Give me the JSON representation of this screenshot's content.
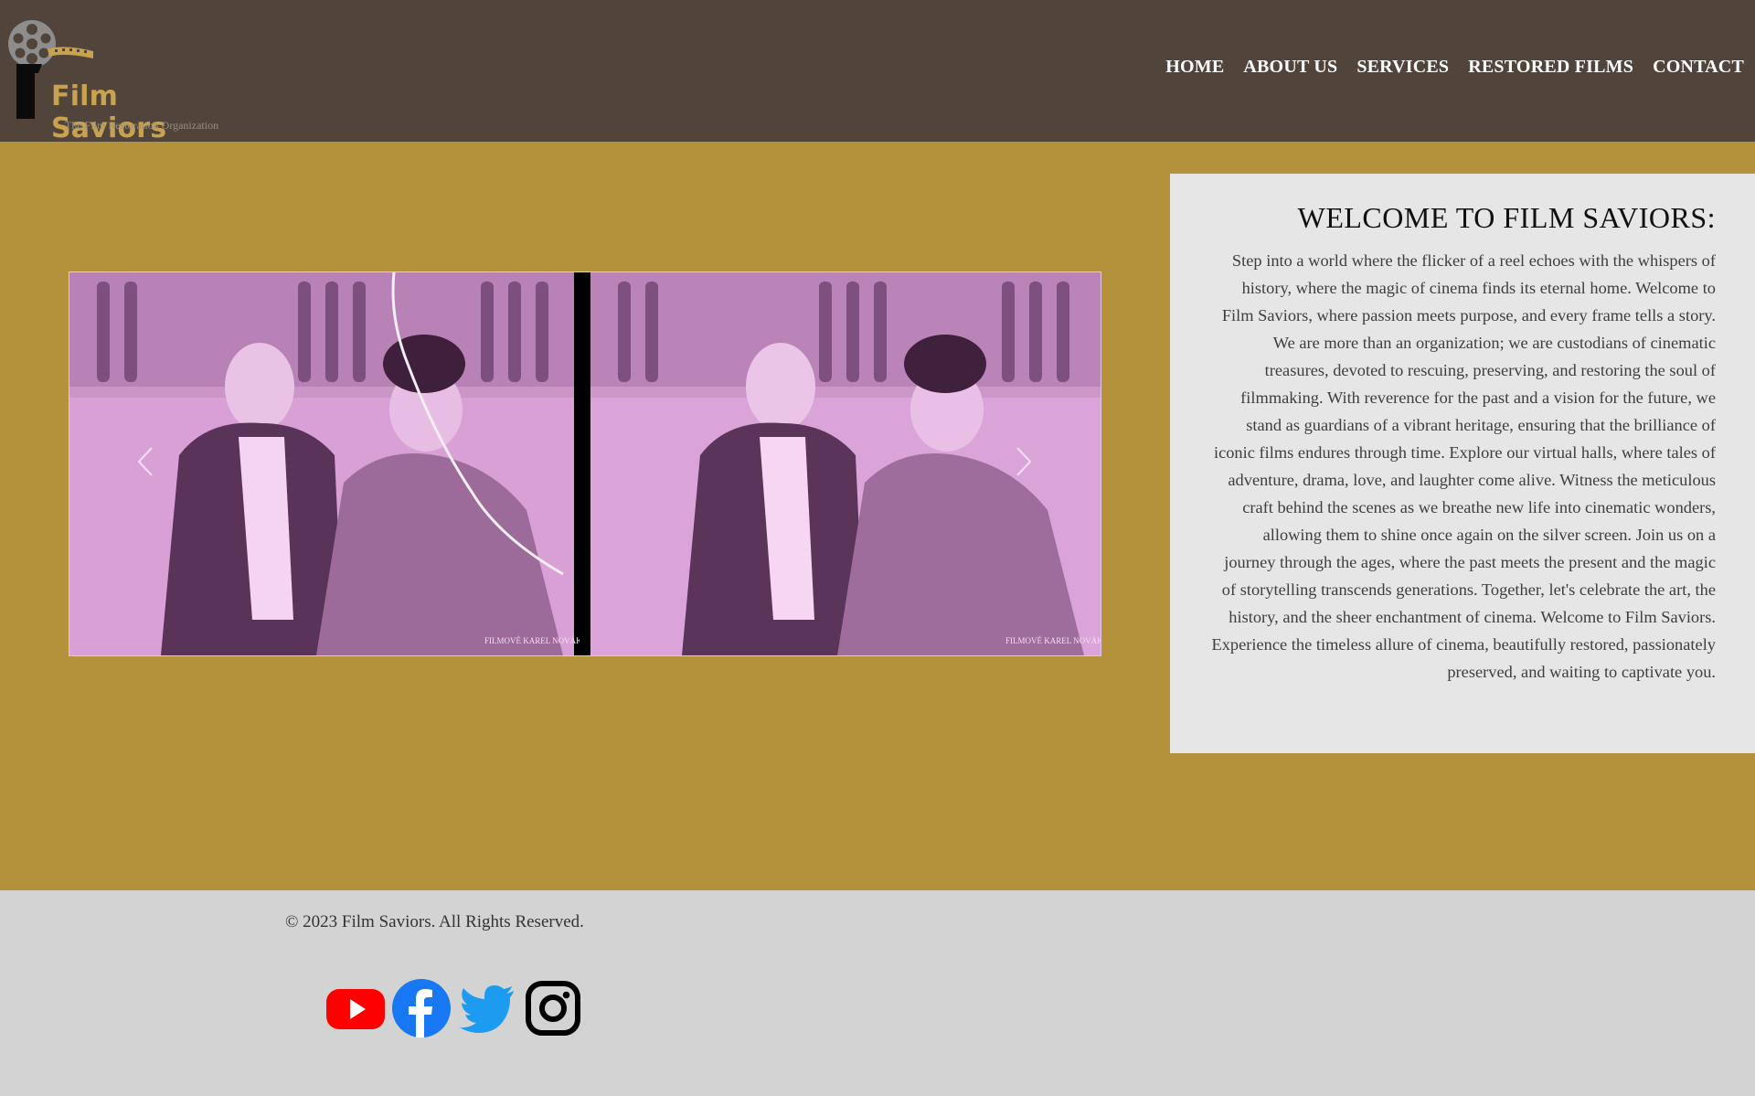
{
  "brand": {
    "name": "Film Saviors",
    "tagline": "The Film Restoration Organization",
    "logo_icon": "film-reel-icon"
  },
  "nav": {
    "items": [
      {
        "label": "HOME"
      },
      {
        "label": "ABOUT US"
      },
      {
        "label": "SERVICES"
      },
      {
        "label": "RESTORED FILMS"
      },
      {
        "label": "CONTACT"
      }
    ]
  },
  "slider": {
    "prev_icon": "chevron-left-icon",
    "next_icon": "chevron-right-icon",
    "watermark_left": "FILMOVÉ KAREL NOVÁK",
    "watermark_right": "FILMOVÉ KAREL NOVÁK"
  },
  "welcome": {
    "title": "WELCOME TO FILM SAVIORS:",
    "body": "Step into a world where the flicker of a reel echoes with the whispers of history, where the magic of cinema finds its eternal home. Welcome to Film Saviors, where passion meets purpose, and every frame tells a story. We are more than an organization; we are custodians of cinematic treasures, devoted to rescuing, preserving, and restoring the soul of filmmaking. With reverence for the past and a vision for the future, we stand as guardians of a vibrant heritage, ensuring that the brilliance of iconic films endures through time. Explore our virtual halls, where tales of adventure, drama, love, and laughter come alive. Witness the meticulous craft behind the scenes as we breathe new life into cinematic wonders, allowing them to shine once again on the silver screen. Join us on a journey through the ages, where the past meets the present and the magic of storytelling transcends generations. Together, let's celebrate the art, the history, and the sheer enchantment of cinema. Welcome to Film Saviors. Experience the timeless allure of cinema, beautifully restored, passionately preserved, and waiting to captivate you."
  },
  "footer": {
    "copyright": "© 2023 Film Saviors. All Rights Reserved.",
    "social": [
      {
        "icon": "youtube-icon",
        "color": "#ff0000"
      },
      {
        "icon": "facebook-icon",
        "color": "#1877f2"
      },
      {
        "icon": "twitter-icon",
        "color": "#1d9bf0"
      },
      {
        "icon": "instagram-icon",
        "color": "#000000"
      }
    ]
  },
  "colors": {
    "header_bg": "#51453b",
    "page_bg": "#b4923b",
    "card_bg": "#e6e6e6",
    "footer_bg": "#d3d3d3",
    "logo_gold": "#c9a24f"
  }
}
